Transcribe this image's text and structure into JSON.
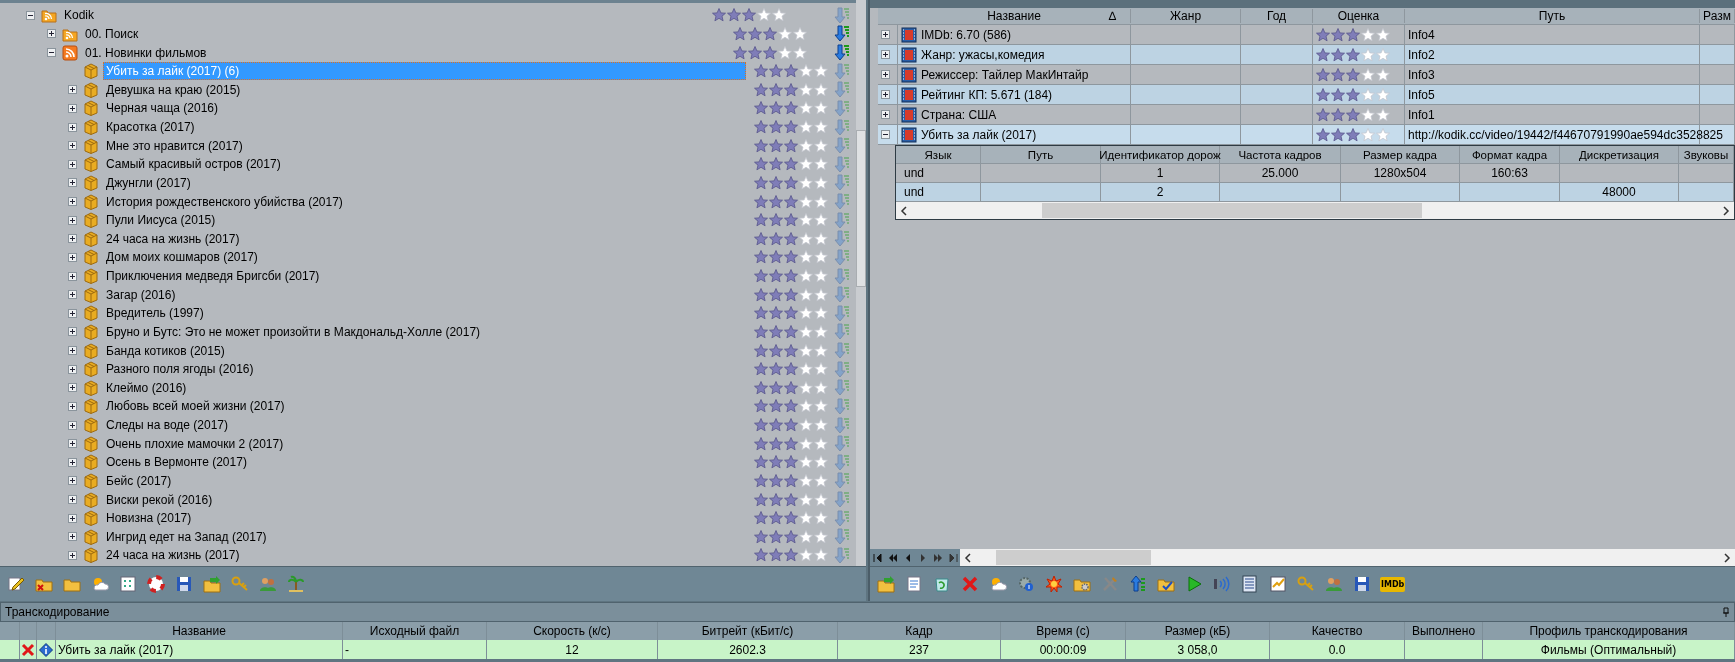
{
  "tree": [
    {
      "label": "Kodik",
      "kind": "feed-folder",
      "expanded": true,
      "selected": false,
      "stars": 3,
      "active": false,
      "children": [
        {
          "label": "00. Поиск",
          "kind": "feed-folder",
          "expanded": false,
          "selected": false,
          "stars": 3,
          "active": true
        },
        {
          "label": "01. Новинки фильмов",
          "kind": "feed",
          "expanded": true,
          "selected": false,
          "stars": 3,
          "active": true,
          "children": [
            {
              "label": "Убить за лайк (2017) (6)",
              "kind": "package",
              "selected": true,
              "stars": 3,
              "active": false
            },
            {
              "label": "Девушка на краю (2015)",
              "kind": "package",
              "expanded": false,
              "selected": false,
              "stars": 3,
              "active": false
            },
            {
              "label": "Черная чаща (2016)",
              "kind": "package",
              "expanded": false,
              "selected": false,
              "stars": 3,
              "active": false
            },
            {
              "label": "Красотка (2017)",
              "kind": "package",
              "expanded": false,
              "selected": false,
              "stars": 3,
              "active": false
            },
            {
              "label": "Мне это нравится (2017)",
              "kind": "package",
              "expanded": false,
              "selected": false,
              "stars": 3,
              "active": false
            },
            {
              "label": "Самый красивый остров (2017)",
              "kind": "package",
              "expanded": false,
              "selected": false,
              "stars": 3,
              "active": false
            },
            {
              "label": "Джунгли (2017)",
              "kind": "package",
              "expanded": false,
              "selected": false,
              "stars": 3,
              "active": false
            },
            {
              "label": "История рождественского убийства (2017)",
              "kind": "package",
              "expanded": false,
              "selected": false,
              "stars": 3,
              "active": false
            },
            {
              "label": "Пули Иисуса (2015)",
              "kind": "package",
              "expanded": false,
              "selected": false,
              "stars": 3,
              "active": false
            },
            {
              "label": "24 часа на жизнь (2017)",
              "kind": "package",
              "expanded": false,
              "selected": false,
              "stars": 3,
              "active": false
            },
            {
              "label": "Дом моих кошмаров (2017)",
              "kind": "package",
              "expanded": false,
              "selected": false,
              "stars": 3,
              "active": false
            },
            {
              "label": "Приключения медведя Бригсби (2017)",
              "kind": "package",
              "expanded": false,
              "selected": false,
              "stars": 3,
              "active": false
            },
            {
              "label": "Загар (2016)",
              "kind": "package",
              "expanded": false,
              "selected": false,
              "stars": 3,
              "active": false
            },
            {
              "label": "Вредитель (1997)",
              "kind": "package",
              "expanded": false,
              "selected": false,
              "stars": 3,
              "active": false
            },
            {
              "label": "Бруно и Бутс: Это не может произойти в Макдональд-Холле (2017)",
              "kind": "package",
              "expanded": false,
              "selected": false,
              "stars": 3,
              "active": false
            },
            {
              "label": "Банда котиков (2015)",
              "kind": "package",
              "expanded": false,
              "selected": false,
              "stars": 3,
              "active": false
            },
            {
              "label": "Разного поля ягоды (2016)",
              "kind": "package",
              "expanded": false,
              "selected": false,
              "stars": 3,
              "active": false
            },
            {
              "label": "Клеймо (2016)",
              "kind": "package",
              "expanded": false,
              "selected": false,
              "stars": 3,
              "active": false
            },
            {
              "label": "Любовь всей моей жизни (2017)",
              "kind": "package",
              "expanded": false,
              "selected": false,
              "stars": 3,
              "active": false
            },
            {
              "label": "Следы на воде (2017)",
              "kind": "package",
              "expanded": false,
              "selected": false,
              "stars": 3,
              "active": false
            },
            {
              "label": "Очень плохие мамочки 2 (2017)",
              "kind": "package",
              "expanded": false,
              "selected": false,
              "stars": 3,
              "active": false
            },
            {
              "label": "Осень в Вермонте (2017)",
              "kind": "package",
              "expanded": false,
              "selected": false,
              "stars": 3,
              "active": false
            },
            {
              "label": "Бейс (2017)",
              "kind": "package",
              "expanded": false,
              "selected": false,
              "stars": 3,
              "active": false
            },
            {
              "label": "Виски рекой (2016)",
              "kind": "package",
              "expanded": false,
              "selected": false,
              "stars": 3,
              "active": false
            },
            {
              "label": "Новизна (2017)",
              "kind": "package",
              "expanded": false,
              "selected": false,
              "stars": 3,
              "active": false
            },
            {
              "label": "Ингрид едет на Запад (2017)",
              "kind": "package",
              "expanded": false,
              "selected": false,
              "stars": 3,
              "active": false
            },
            {
              "label": "24 часа на жизнь (2017)",
              "kind": "package",
              "expanded": false,
              "selected": false,
              "stars": 3,
              "active": false
            }
          ]
        }
      ]
    }
  ],
  "table": {
    "columns": [
      "Название",
      "Жанр",
      "Год",
      "Оценка",
      "Путь",
      "Разм"
    ],
    "sort_mark": "∆",
    "rows": [
      {
        "name": "IMDb: 6.70 (586)",
        "genre": "",
        "year": "",
        "stars": 3,
        "path": "Info4",
        "expanded": false
      },
      {
        "name": "Жанр: ужасы,комедия",
        "genre": "",
        "year": "",
        "stars": 3,
        "path": "Info2",
        "expanded": false
      },
      {
        "name": "Режиссер: Тайлер МакИнтайр",
        "genre": "",
        "year": "",
        "stars": 3,
        "path": "Info3",
        "expanded": false
      },
      {
        "name": "Рейтинг КП: 5.671 (184)",
        "genre": "",
        "year": "",
        "stars": 3,
        "path": "Info5",
        "expanded": false
      },
      {
        "name": "Страна: США",
        "genre": "",
        "year": "",
        "stars": 3,
        "path": "Info1",
        "expanded": false
      },
      {
        "name": "Убить за лайк (2017)",
        "genre": "",
        "year": "",
        "stars": 3,
        "path": "http://kodik.cc/video/19442/f44670791990ae594dc3528825",
        "expanded": true,
        "details": {
          "columns": [
            "Язык",
            "Путь",
            "Идентификатор дорож",
            "Частота кадров",
            "Размер кадра",
            "Формат кадра",
            "Дискретизация",
            "Звуковы"
          ],
          "rows": [
            [
              "und",
              "",
              "1",
              "25.000",
              "1280x504",
              "160:63",
              "",
              ""
            ],
            [
              "und",
              "",
              "2",
              "",
              "",
              "",
              "48000",
              ""
            ]
          ]
        }
      }
    ]
  },
  "toolbar_logo": "IMDb",
  "transcoding": {
    "title": "Транскодирование",
    "columns": [
      "Название",
      "Исходный файл",
      "Скорость (к/с)",
      "Битрейт (кБит/с)",
      "Кадр",
      "Время (с)",
      "Размер (кБ)",
      "Качество",
      "Выполнено",
      "Профиль транскодирования"
    ],
    "rows": [
      {
        "cells": [
          "Убить за лайк (2017)",
          "-",
          "12",
          "2602.3",
          "237",
          "00:00:09",
          "3 058,0",
          "0.0",
          "",
          "Фильмы (Оптимальный)"
        ]
      }
    ]
  }
}
